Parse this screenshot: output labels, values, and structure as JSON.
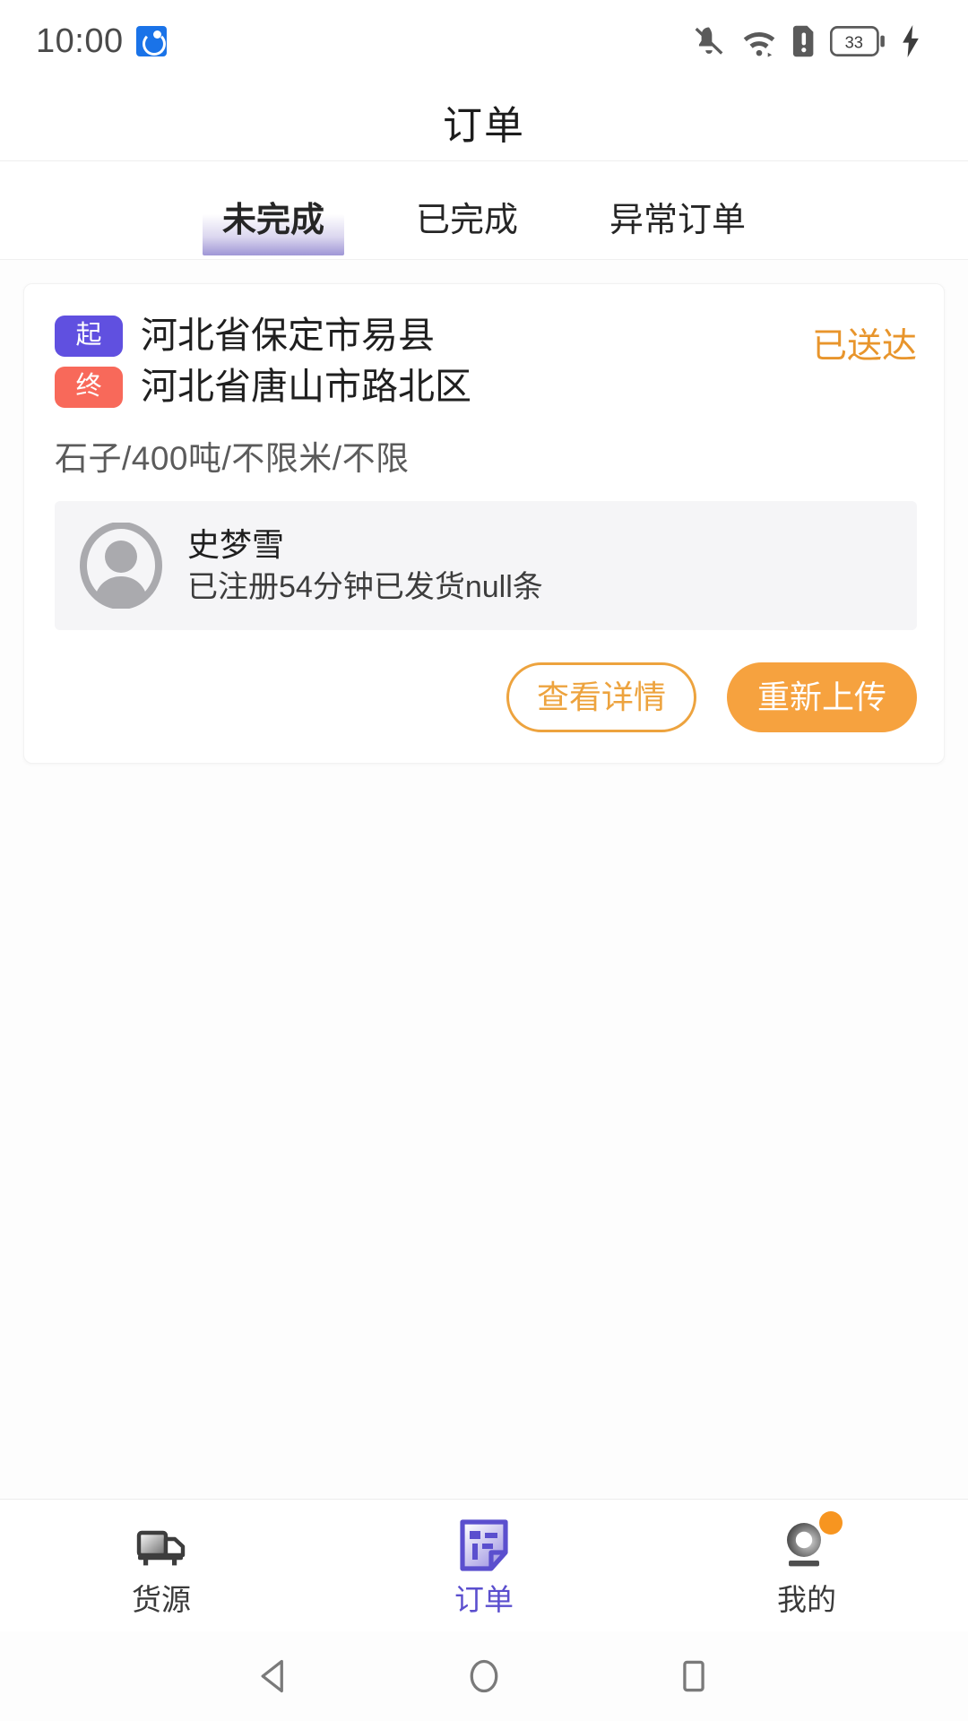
{
  "statusbar": {
    "time": "10:00",
    "app_icon": "app-badge-icon",
    "icons": [
      "bell-muted-icon",
      "wifi-icon",
      "sim-alert-icon",
      "battery-icon",
      "charging-bolt-icon"
    ],
    "battery_level": "33"
  },
  "header": {
    "title": "订单"
  },
  "tabs": [
    {
      "label": "未完成",
      "active": true
    },
    {
      "label": "已完成",
      "active": false
    },
    {
      "label": "异常订单",
      "active": false
    }
  ],
  "orders": [
    {
      "start_badge": "起",
      "start_address": "河北省保定市易县",
      "end_badge": "终",
      "end_address": "河北省唐山市路北区",
      "status": "已送达",
      "cargo": "石子/400吨/不限米/不限",
      "shipper_name": "史梦雪",
      "shipper_meta": "已注册54分钟已发货null条",
      "detail_button": "查看详情",
      "upload_button": "重新上传"
    }
  ],
  "bottom_nav": [
    {
      "label": "货源",
      "icon": "truck-icon",
      "active": false,
      "badge": false
    },
    {
      "label": "订单",
      "icon": "order-document-icon",
      "active": true,
      "badge": false
    },
    {
      "label": "我的",
      "icon": "profile-icon",
      "active": false,
      "badge": true
    }
  ],
  "android_nav": {
    "back": "back-triangle-icon",
    "home": "home-circle-icon",
    "recents": "recents-square-icon"
  },
  "colors": {
    "accent_orange": "#f6a23f",
    "status_orange": "#e8952c",
    "badge_start_purple": "#6050e0",
    "badge_end_red": "#f8695a",
    "tab_active_purple": "#9f96d6",
    "nav_active_purple": "#5b4fce"
  }
}
